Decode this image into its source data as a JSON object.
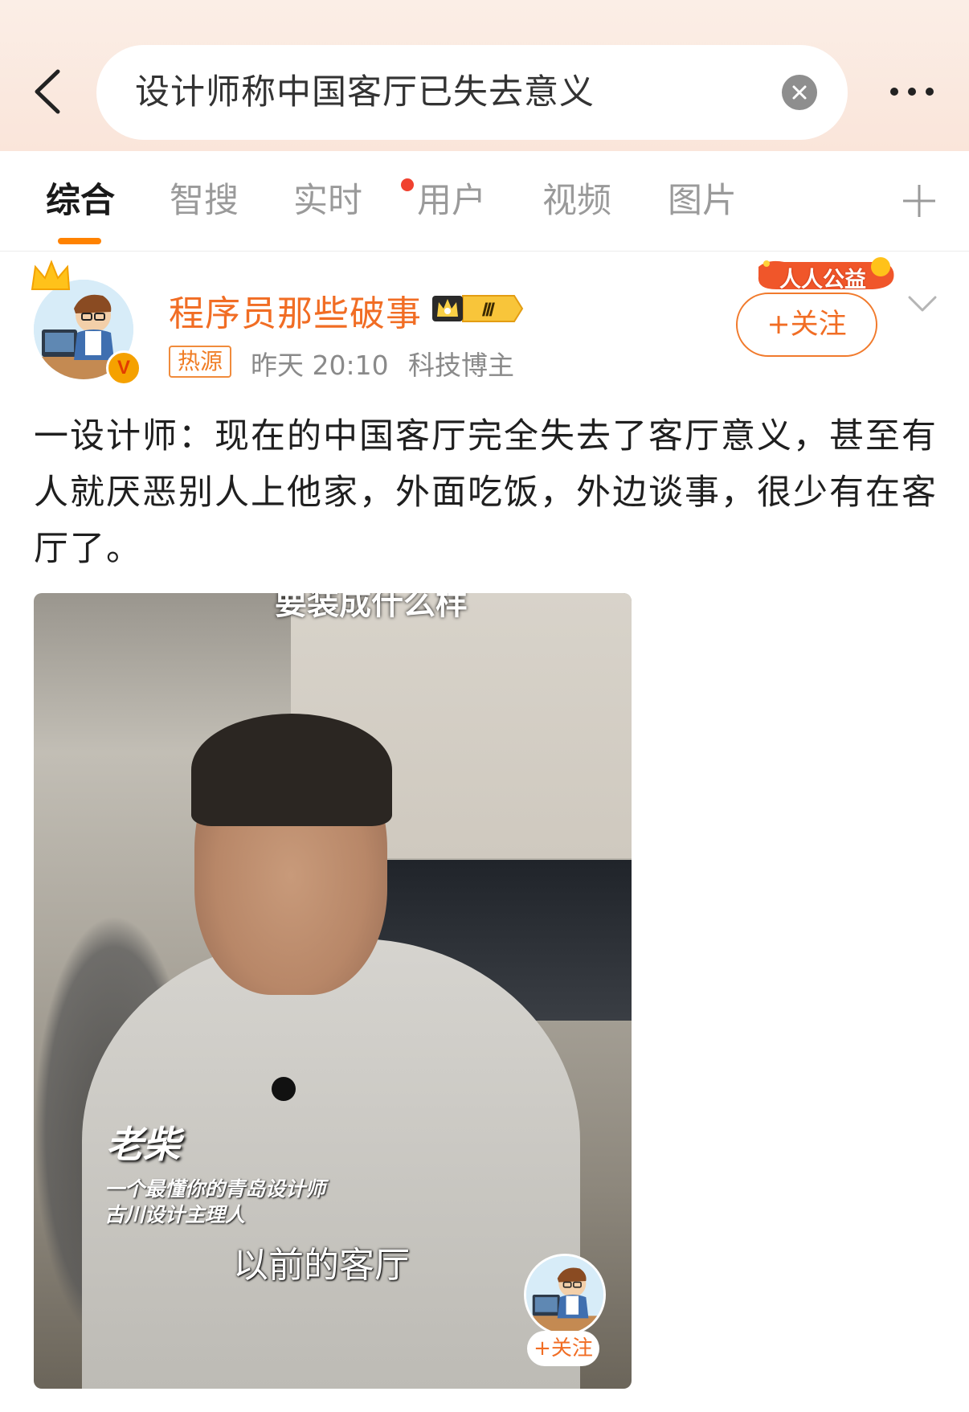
{
  "search": {
    "query": "设计师称中国客厅已失去意义"
  },
  "tabs": [
    {
      "label": "综合"
    },
    {
      "label": "智搜"
    },
    {
      "label": "实时"
    },
    {
      "label": "用户"
    },
    {
      "label": "视频"
    },
    {
      "label": "图片"
    }
  ],
  "post": {
    "username": "程序员那些破事",
    "level_badge": "Ⅲ",
    "hot_tag": "热源",
    "time": "昨天 20:10",
    "category": "科技博主",
    "charity_badge": "人人公益",
    "follow_label": "+关注",
    "text": "一设计师：现在的中国客厅完全失去了客厅意义，甚至有人就厌恶别人上他家，外面吃饭，外边谈事，很少有在客厅了。",
    "video": {
      "top_caption": "要装成什么样",
      "name_caption": "老柴",
      "sub_caption_1": "一个最懂你的青岛设计师",
      "sub_caption_2": "古川设计主理人",
      "subtitle": "以前的客厅",
      "follow_label": "+关注"
    }
  },
  "colors": {
    "accent": "#ff8200",
    "username": "#f16d24",
    "header_bg": "#fae5da"
  }
}
